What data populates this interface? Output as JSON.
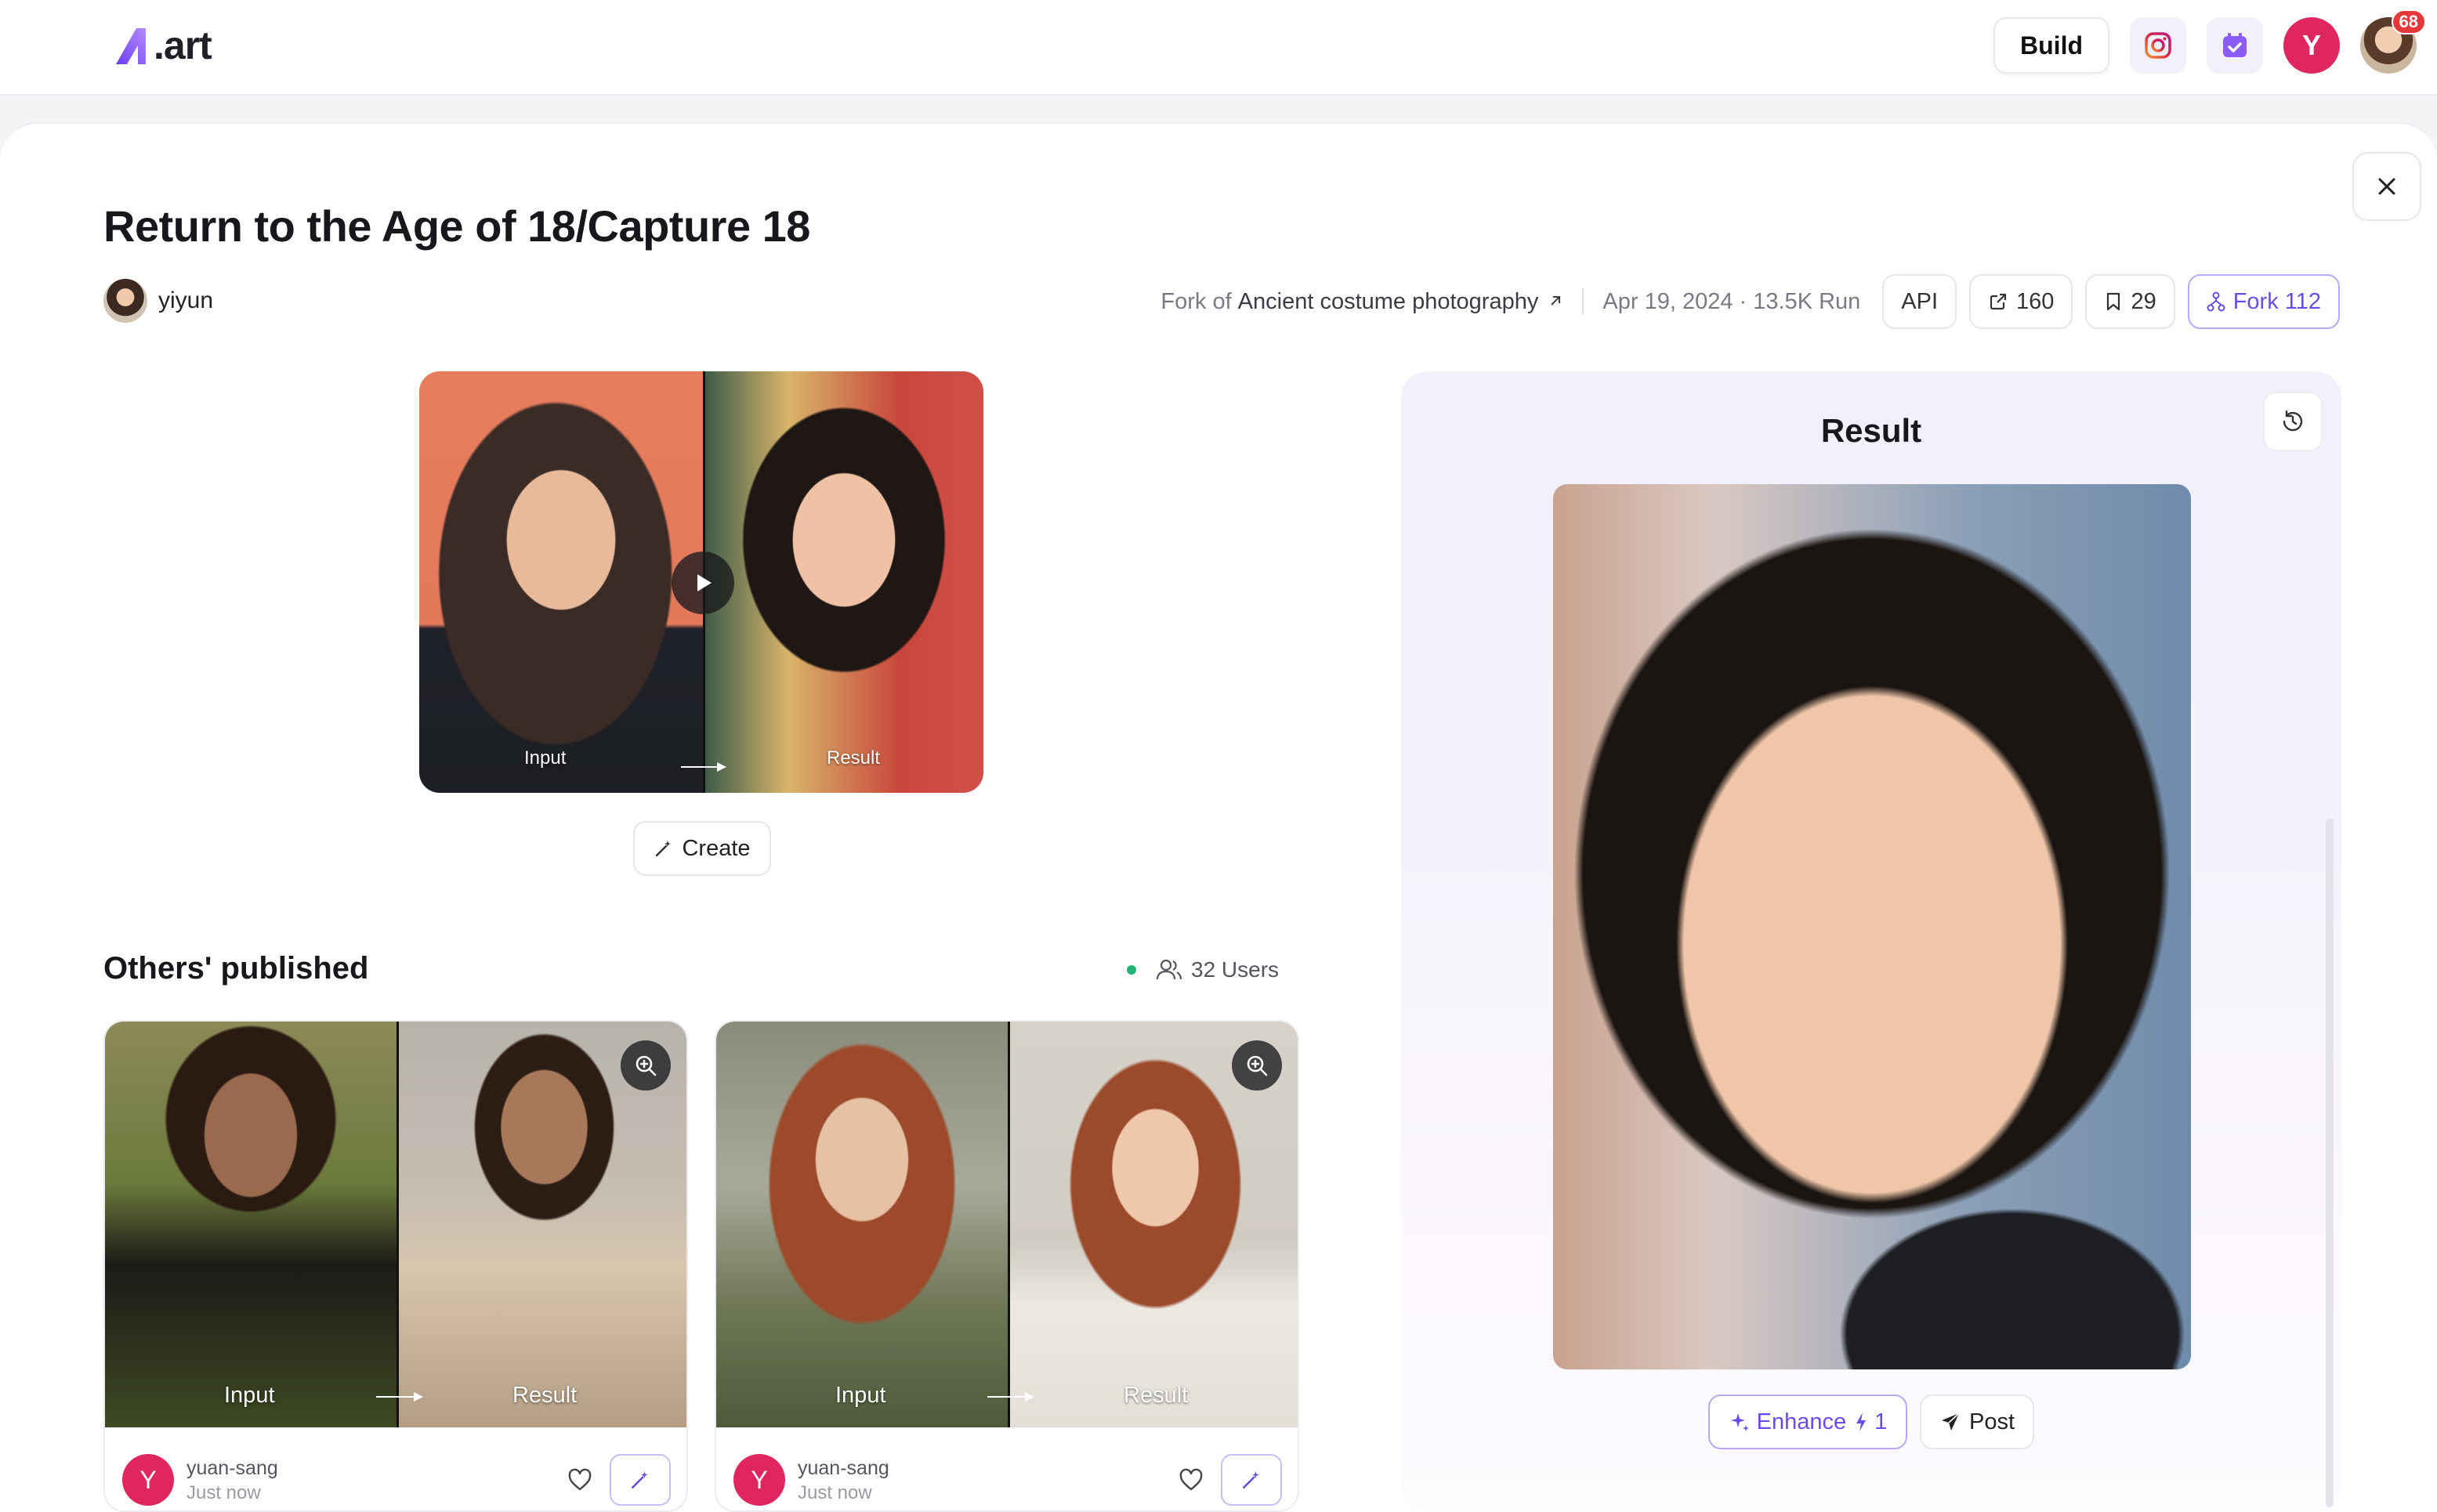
{
  "topbar": {
    "logo_text": ".art",
    "build_label": "Build",
    "notification_count": "68",
    "user_initial": "Y"
  },
  "page": {
    "title": "Return to the Age of 18/Capture 18",
    "author": "yiyun",
    "fork_prefix": "Fork of",
    "fork_source": "Ancient costume photography",
    "date_runs": "Apr 19, 2024 · 13.5K Run",
    "api_label": "API",
    "share_count": "160",
    "bookmark_count": "29",
    "fork_label": "Fork 112"
  },
  "demo": {
    "input_label": "Input",
    "result_label": "Result",
    "create_label": "Create"
  },
  "others": {
    "title": "Others' published",
    "users_label": "32 Users",
    "cards": [
      {
        "input_label": "Input",
        "result_label": "Result",
        "user_initial": "Y",
        "username": "yuan-sang",
        "time": "Just now"
      },
      {
        "input_label": "Input",
        "result_label": "Result",
        "user_initial": "Y",
        "username": "yuan-sang",
        "time": "Just now"
      }
    ]
  },
  "result": {
    "title": "Result",
    "enhance_label": "Enhance",
    "enhance_cost": "1",
    "post_label": "Post"
  },
  "colors": {
    "accent": "#6b4ce6",
    "avatar_pink": "#e0265f",
    "online_green": "#22b573",
    "badge_red": "#e5383b"
  }
}
